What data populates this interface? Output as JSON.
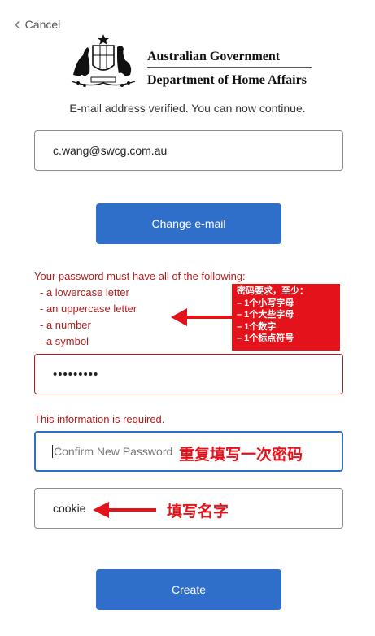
{
  "nav": {
    "cancel_label": "Cancel"
  },
  "header": {
    "gov_title": "Australian Government",
    "department": "Department of Home Affairs"
  },
  "status_message": "E-mail address verified. You can now continue.",
  "email": {
    "value": "c.wang@swcg.com.au"
  },
  "change_email_button": "Change e-mail",
  "password_requirements": {
    "header": "Your password must have all of the following:",
    "items": [
      "- a lowercase letter",
      "- an uppercase letter",
      "- a number",
      "- a symbol"
    ]
  },
  "annotation_box": {
    "lines": [
      "密码要求，至少：",
      "– 1个小写字母",
      "– 1个大些字母",
      "– 1个数字",
      "– 1个标点符号"
    ]
  },
  "password": {
    "masked_value": "•••••••••"
  },
  "required_message": "This information is required.",
  "confirm_password": {
    "placeholder": "Confirm New Password"
  },
  "confirm_annotation": "重复填写一次密码",
  "name": {
    "value": "cookie"
  },
  "name_annotation": "填写名字",
  "create_button": "Create",
  "colors": {
    "primary_button": "#2f6fc9",
    "error_text": "#b31b1b",
    "annotation_red": "#e3131c"
  },
  "icons": [
    "back-chevron-icon",
    "coat-of-arms-crest",
    "red-arrow-icon"
  ]
}
